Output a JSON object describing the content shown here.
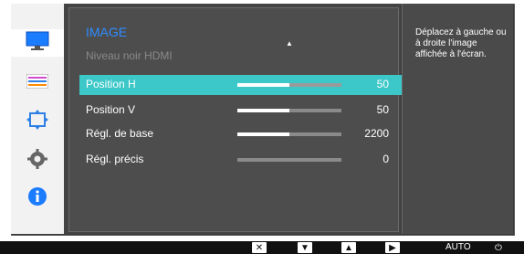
{
  "menu": {
    "title": "IMAGE",
    "subtitle": "Niveau noir HDMI",
    "rows": [
      {
        "label": "Position H",
        "value": "50",
        "level": 0.5,
        "selected": true
      },
      {
        "label": "Position V",
        "value": "50",
        "level": 0.5,
        "selected": false
      },
      {
        "label": "Régl. de base",
        "value": "2200",
        "level": 0.5,
        "selected": false
      },
      {
        "label": "Régl. précis",
        "value": "0",
        "level": 0.0,
        "selected": false
      }
    ]
  },
  "help": {
    "text": "Déplacez à gauche ou à droite l'image affichée à l'écran."
  },
  "sidebar": {
    "icons": [
      "monitor-icon",
      "color-icon",
      "resize-icon",
      "settings-icon",
      "info-icon"
    ]
  },
  "bottom_bar": {
    "auto_label": "AUTO"
  },
  "colors": {
    "selection": "#3cc7c8",
    "title": "#2f8bff",
    "info_icon": "#1a7cff"
  }
}
